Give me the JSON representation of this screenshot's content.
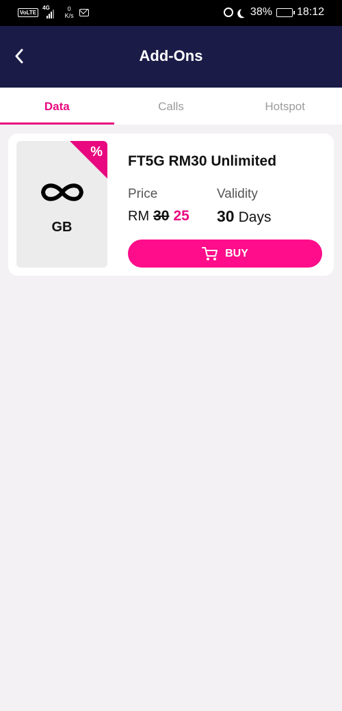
{
  "status_bar": {
    "volte": "VoLTE",
    "network": "4G",
    "speed_value": "0",
    "speed_unit": "K/s",
    "battery": "38%",
    "battery_level": 0.38,
    "time": "18:12"
  },
  "header": {
    "title": "Add-Ons"
  },
  "tabs": [
    {
      "label": "Data",
      "active": true
    },
    {
      "label": "Calls",
      "active": false
    },
    {
      "label": "Hotspot",
      "active": false
    }
  ],
  "plan": {
    "badge": "%",
    "unit": "GB",
    "name": "FT5G RM30 Unlimited",
    "price_label": "Price",
    "currency": "RM",
    "old_price": "30",
    "new_price": "25",
    "validity_label": "Validity",
    "validity_value": "30",
    "validity_unit": "Days",
    "buy_label": "BUY"
  },
  "colors": {
    "accent": "#e8087f",
    "header": "#1b1b48",
    "background": "#f3f1f3"
  }
}
